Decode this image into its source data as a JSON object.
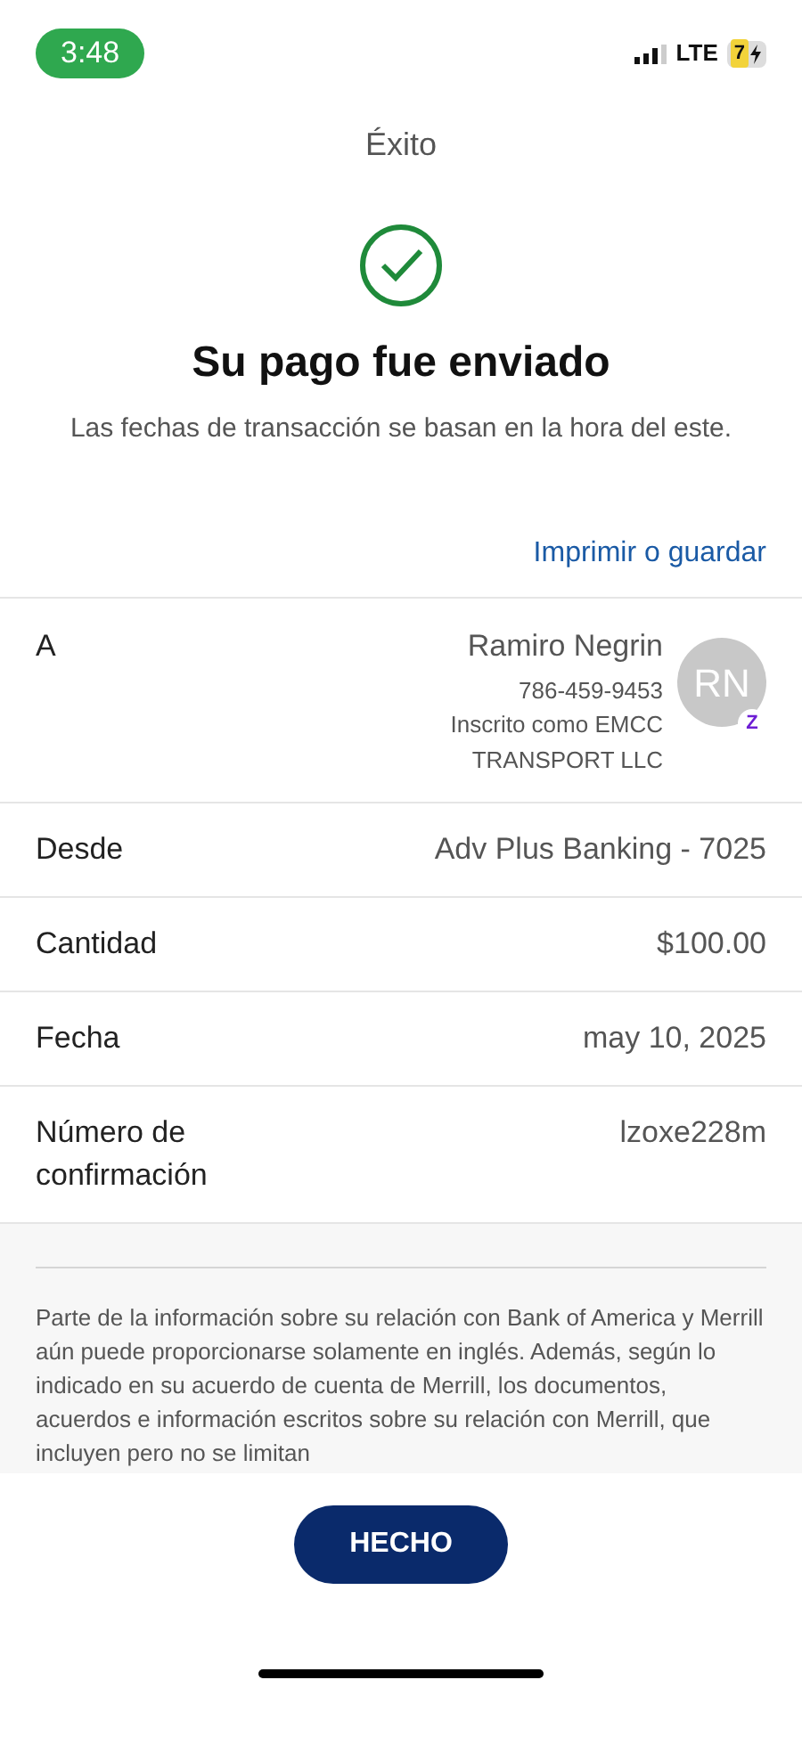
{
  "status_bar": {
    "time": "3:48",
    "network": "LTE",
    "battery": "7"
  },
  "header": {
    "title": "Éxito"
  },
  "result": {
    "heading": "Su pago fue enviado",
    "note": "Las fechas de transacción se basan en la hora del este."
  },
  "print_link": "Imprimir o guardar",
  "recipient": {
    "label": "A",
    "name": "Ramiro Negrin",
    "phone": "786-459-9453",
    "lines": [
      "Inscrito como EMCC",
      "TRANSPORT LLC"
    ],
    "initials": "RN",
    "badge": "Z"
  },
  "details": [
    {
      "label": "Desde",
      "value": "Adv Plus Banking - 7025"
    },
    {
      "label": "Cantidad",
      "value": "$100.00"
    },
    {
      "label": "Fecha",
      "value": "may 10, 2025"
    },
    {
      "label": "Número de confirmación",
      "value": "lzoxe228m"
    }
  ],
  "disclaimer": "Parte de la información sobre su relación con Bank of America y Merrill aún puede proporcionarse solamente en inglés. Además, según lo indicado en su acuerdo de cuenta de Merrill, los documentos, acuerdos e información escritos sobre su relación con Merrill, que incluyen pero no se limitan",
  "done_button": "HECHO"
}
